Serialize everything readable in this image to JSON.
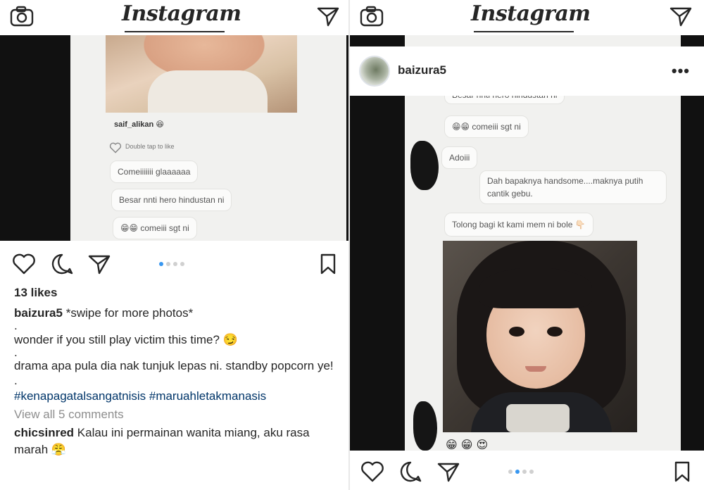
{
  "app": {
    "logo": "Instagram"
  },
  "left_post": {
    "screenshot": {
      "commenter": "saif_alikan",
      "commenter_emoji": "😆",
      "like_hint": "Double tap to like",
      "bubbles": [
        "Comeiiiiiii glaaaaaa",
        "Besar nnti hero hindustan ni",
        "comeiii sgt ni"
      ],
      "bubble3_emoji": "😁😁"
    },
    "carousel": {
      "count": 4,
      "active": 0
    },
    "likes": "13 likes",
    "caption": {
      "username": "baizura5",
      "text": "*swipe for more photos*",
      "dot1": ".",
      "line2": "wonder if you still play victim this time? 😏",
      "dot2": ".",
      "line3": "drama apa pula dia nak tunjuk lepas ni. standby popcorn ye! .",
      "hashtags": "#kenapagatalsangatnisis #maruahletakmanasis"
    },
    "view_all": "View all 5 comments",
    "comment": {
      "username": "chicsinred",
      "text": "Kalau ini permainan wanita miang, aku rasa marah 😤"
    }
  },
  "right_post": {
    "username": "baizura5",
    "more": "•••",
    "screenshot": {
      "bubbles": [
        "Besar nnti hero hindustan ni",
        "comeiii sgt ni",
        "Adoiii",
        "Dah bapaknya handsome....maknya putih cantik gebu.",
        "Tolong bagi kt kami mem ni bole 👇🏻"
      ],
      "bubble2_emoji": "😁😁",
      "bottom_emojis": "😁 😁 😍"
    },
    "carousel": {
      "count": 4,
      "active": 1
    }
  },
  "colors": {
    "accent": "#3897f0",
    "hashtag": "#003569",
    "muted": "#8e8e8e"
  }
}
